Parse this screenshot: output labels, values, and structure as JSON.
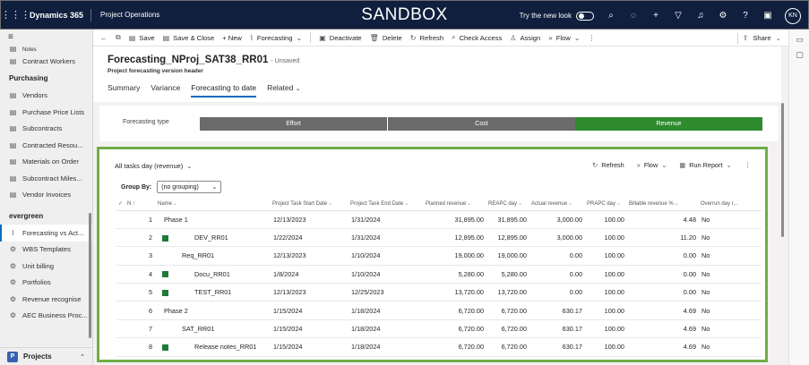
{
  "topbar": {
    "brand": "Dynamics 365",
    "app": "Project Operations",
    "environment": "SANDBOX",
    "try_new_look": "Try the new look",
    "avatar_initials": "KN"
  },
  "leftnav": {
    "top_items": [
      {
        "label": "Notes",
        "icon": "note-icon"
      },
      {
        "label": "Contract Workers",
        "icon": "contract-workers-icon"
      }
    ],
    "purchasing_header": "Purchasing",
    "purchasing_items": [
      {
        "label": "Vendors",
        "icon": "vendors-icon"
      },
      {
        "label": "Purchase Price Lists",
        "icon": "price-list-icon"
      },
      {
        "label": "Subcontracts",
        "icon": "subcontracts-icon"
      },
      {
        "label": "Contracted Resou...",
        "icon": "contracted-resource-icon"
      },
      {
        "label": "Materials on Order",
        "icon": "materials-icon"
      },
      {
        "label": "Subcontract Miles...",
        "icon": "milestone-icon"
      },
      {
        "label": "Vendor Invoices",
        "icon": "invoice-icon"
      }
    ],
    "evergreen_header": "evergreen",
    "evergreen_items": [
      {
        "label": "Forecasting vs Act...",
        "icon": "chart-icon",
        "selected": true
      },
      {
        "label": "WBS Templates",
        "icon": "gear-icon"
      },
      {
        "label": "Unit billing",
        "icon": "gear-icon"
      },
      {
        "label": "Portfolios",
        "icon": "gear-icon"
      },
      {
        "label": "Revenue recognise",
        "icon": "gear-icon"
      },
      {
        "label": "AEC Business Proc...",
        "icon": "gear-icon"
      }
    ],
    "area": {
      "badge": "P",
      "label": "Projects"
    }
  },
  "cmdbar": {
    "save": "Save",
    "save_close": "Save & Close",
    "new": "+ New",
    "forecasting": "Forecasting",
    "deactivate": "Deactivate",
    "delete": "Delete",
    "refresh": "Refresh",
    "check_access": "Check Access",
    "assign": "Assign",
    "flow": "Flow",
    "share": "Share"
  },
  "record": {
    "title": "Forecasting_NProj_SAT38_RR01",
    "status": "- Unsaved",
    "entity": "Project forecasting version header",
    "tabs": [
      "Summary",
      "Variance",
      "Forecasting to date",
      "Related"
    ],
    "active_tab": "Forecasting to date"
  },
  "forecast_type": {
    "label": "Forecasting type",
    "options": [
      "Effort",
      "Cost",
      "Revenue"
    ],
    "selected": "Revenue"
  },
  "grid": {
    "view_name": "All tasks day (revenue)",
    "actions": {
      "refresh": "Refresh",
      "flow": "Flow",
      "run_report": "Run Report"
    },
    "group_by_label": "Group By:",
    "group_by_value": "(no grouping)",
    "columns": {
      "rownum": "N ↑",
      "name": "Name",
      "start": "Project Task Start Date",
      "end": "Project Task End Date",
      "planned": "Planned revenue",
      "reapc": "REAPC day",
      "actual": "Actual revenue",
      "prapc": "PRAPC day",
      "billable": "Billable revenue %",
      "overrun": "Overrun day r..."
    },
    "rows": [
      {
        "n": "1",
        "name": "Phase 1",
        "start": "12/13/2023",
        "end": "1/31/2024",
        "planned": "31,895.00",
        "reapc": "31,895.00",
        "actual": "3,000.00",
        "prapc": "100.00",
        "billable": "4.48",
        "overrun": "No",
        "level": 0,
        "sq": false
      },
      {
        "n": "2",
        "name": "DEV_RR01",
        "start": "1/22/2024",
        "end": "1/31/2024",
        "planned": "12,895.00",
        "reapc": "12,895.00",
        "actual": "3,000.00",
        "prapc": "100.00",
        "billable": "11.20",
        "overrun": "No",
        "level": 2,
        "sq": true
      },
      {
        "n": "3",
        "name": "Req_RR01",
        "start": "12/13/2023",
        "end": "1/10/2024",
        "planned": "19,000.00",
        "reapc": "19,000.00",
        "actual": "0.00",
        "prapc": "100.00",
        "billable": "0.00",
        "overrun": "No",
        "level": 1,
        "sq": false
      },
      {
        "n": "4",
        "name": "Docu_RR01",
        "start": "1/8/2024",
        "end": "1/10/2024",
        "planned": "5,280.00",
        "reapc": "5,280.00",
        "actual": "0.00",
        "prapc": "100.00",
        "billable": "0.00",
        "overrun": "No",
        "level": 2,
        "sq": true
      },
      {
        "n": "5",
        "name": "TEST_RR01",
        "start": "12/13/2023",
        "end": "12/25/2023",
        "planned": "13,720.00",
        "reapc": "13,720.00",
        "actual": "0.00",
        "prapc": "100.00",
        "billable": "0.00",
        "overrun": "No",
        "level": 2,
        "sq": true
      },
      {
        "n": "6",
        "name": "Phase 2",
        "start": "1/15/2024",
        "end": "1/18/2024",
        "planned": "6,720.00",
        "reapc": "6,720.00",
        "actual": "630.17",
        "prapc": "100.00",
        "billable": "4.69",
        "overrun": "No",
        "level": 0,
        "sq": false
      },
      {
        "n": "7",
        "name": "SAT_RR01",
        "start": "1/15/2024",
        "end": "1/18/2024",
        "planned": "6,720.00",
        "reapc": "6,720.00",
        "actual": "630.17",
        "prapc": "100.00",
        "billable": "4.69",
        "overrun": "No",
        "level": 1,
        "sq": false
      },
      {
        "n": "8",
        "name": "Release notes_RR01",
        "start": "1/15/2024",
        "end": "1/18/2024",
        "planned": "6,720.00",
        "reapc": "6,720.00",
        "actual": "630.17",
        "prapc": "100.00",
        "billable": "4.69",
        "overrun": "No",
        "level": 2,
        "sq": true
      }
    ]
  },
  "colors": {
    "topbar": "#0f1f3d",
    "segment_gray": "#6b6b6b",
    "segment_selected": "#2e8b2e",
    "highlight_border": "#70ad47",
    "task_square": "#1e7a3a",
    "accent": "#0f6cbd"
  }
}
